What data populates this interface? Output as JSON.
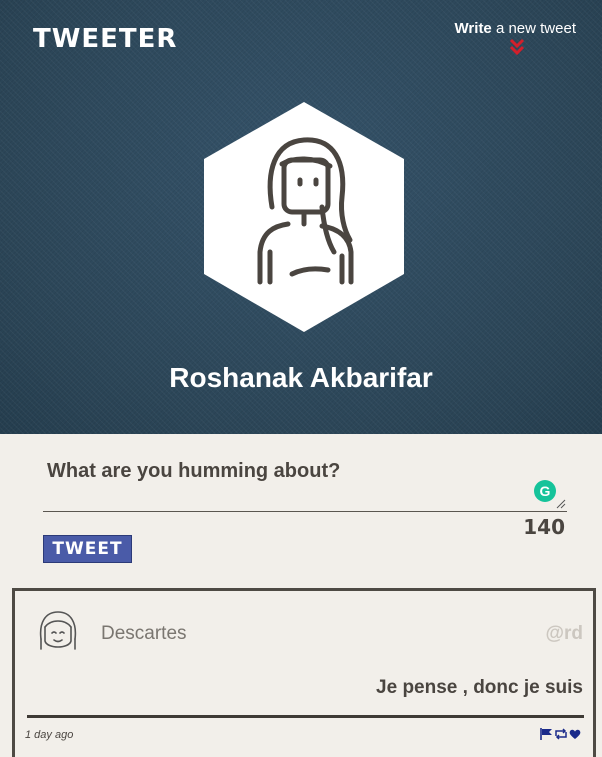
{
  "header": {
    "logo": "TWEETER",
    "write_bold": "Write",
    "write_rest": " a new tweet"
  },
  "profile": {
    "name": "Roshanak Akbarifar",
    "avatar_icon": "woman-avatar-icon"
  },
  "compose": {
    "placeholder": "What are you humming about?",
    "char_count": "140",
    "tweet_label": "TWEET"
  },
  "tweets": [
    {
      "name": "Descartes",
      "handle": "@rd",
      "text": "Je pense , donc je suis",
      "time": "1 day ago",
      "actions": [
        "flag-icon",
        "retweet-icon",
        "heart-icon"
      ]
    }
  ],
  "colors": {
    "hero_bg": "#2f4a5c",
    "page_bg": "#f2efea",
    "accent_red": "#d21f2b",
    "tweet_button": "#4a5ba8",
    "action_icons": "#1a2a8a",
    "grammarly": "#15c39a"
  }
}
